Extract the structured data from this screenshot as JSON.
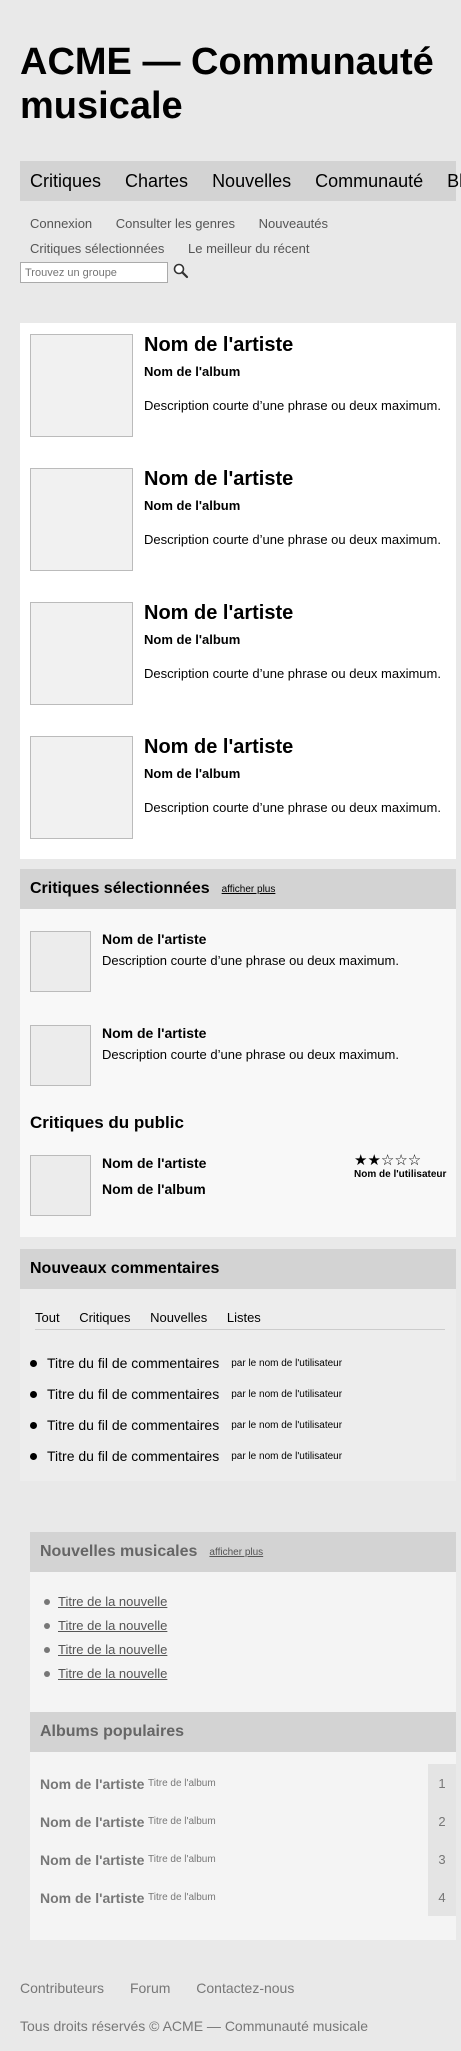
{
  "site": {
    "title": "ACME — Communauté musicale"
  },
  "mainnav": [
    "Critiques",
    "Chartes",
    "Nouvelles",
    "Communauté",
    "Blog"
  ],
  "subnav_row1": [
    "Connexion",
    "Consulter les genres",
    "Nouveautés"
  ],
  "subnav_row2": [
    "Critiques sélectionnées",
    "Le meilleur du récent"
  ],
  "search": {
    "placeholder": "Trouvez un groupe",
    "icon": "search-icon"
  },
  "featured": [
    {
      "artist": "Nom de l'artiste",
      "album": "Nom de l'album",
      "desc": "Description courte d’une phrase ou deux maximum."
    },
    {
      "artist": "Nom de l'artiste",
      "album": "Nom de l'album",
      "desc": "Description courte d’une phrase ou deux maximum."
    },
    {
      "artist": "Nom de l'artiste",
      "album": "Nom de l'album",
      "desc": "Description courte d’une phrase ou deux maximum."
    },
    {
      "artist": "Nom de l'artiste",
      "album": "Nom de l'album",
      "desc": "Description courte d’une phrase ou deux maximum."
    }
  ],
  "critiques": {
    "title": "Critiques sélectionnées",
    "more": "afficher plus",
    "items": [
      {
        "artist": "Nom de l'artiste",
        "desc": "Description courte d’une phrase ou deux maximum."
      },
      {
        "artist": "Nom de l'artiste",
        "desc": "Description courte d’une phrase ou deux maximum."
      }
    ],
    "public_title": "Critiques du public",
    "public": {
      "artist": "Nom de l'artiste",
      "album": "Nom de l'album",
      "stars": "★★☆☆☆",
      "rating": 2,
      "user": "Nom de l'utilisateur"
    }
  },
  "comments": {
    "title": "Nouveaux commentaires",
    "tabs": [
      "Tout",
      "Critiques",
      "Nouvelles",
      "Listes"
    ],
    "items": [
      {
        "title": "Titre du fil de commentaires",
        "by": "par le nom de l'utilisateur"
      },
      {
        "title": "Titre du fil de commentaires",
        "by": "par le nom de l'utilisateur"
      },
      {
        "title": "Titre du fil de commentaires",
        "by": "par le nom de l'utilisateur"
      },
      {
        "title": "Titre du fil de commentaires",
        "by": "par le nom de l'utilisateur"
      }
    ]
  },
  "news": {
    "title": "Nouvelles musicales",
    "more": "afficher plus",
    "items": [
      "Titre de la nouvelle",
      "Titre de la nouvelle",
      "Titre de la nouvelle",
      "Titre de la nouvelle"
    ]
  },
  "albums": {
    "title": "Albums populaires",
    "items": [
      {
        "artist": "Nom de l'artiste",
        "title": "Titre de l'album",
        "rank": "1"
      },
      {
        "artist": "Nom de l'artiste",
        "title": "Titre de l'album",
        "rank": "2"
      },
      {
        "artist": "Nom de l'artiste",
        "title": "Titre de l'album",
        "rank": "3"
      },
      {
        "artist": "Nom de l'artiste",
        "title": "Titre de l'album",
        "rank": "4"
      }
    ]
  },
  "footer": {
    "links": [
      "Contributeurs",
      "Forum",
      "Contactez-nous"
    ],
    "copyright": "Tous droits réservés © ACME — Communauté musicale"
  },
  "colors": {
    "background": "#e9e9e9",
    "panel_header": "#d3d3d3",
    "panel": "#ffffff"
  }
}
